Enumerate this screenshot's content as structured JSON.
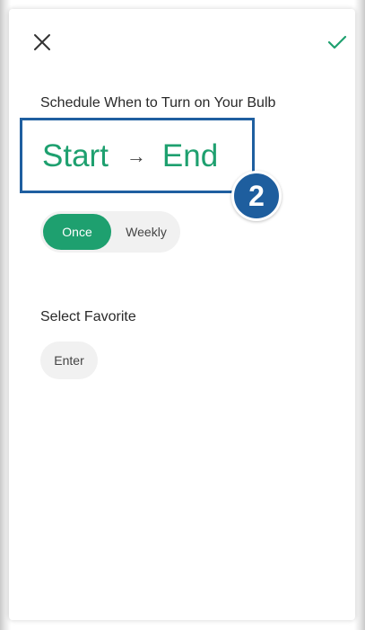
{
  "header": {
    "close_icon": "close-icon",
    "confirm_icon": "checkmark-icon",
    "accent_color": "#1ea06f"
  },
  "schedule": {
    "title": "Schedule When to Turn on Your Bulb",
    "start_label": "Start",
    "arrow": "→",
    "end_label": "End"
  },
  "annotation": {
    "badge_number": "2",
    "highlight_color": "#1f5fa0"
  },
  "repeat": {
    "options": [
      {
        "label": "Once",
        "selected": true
      },
      {
        "label": "Weekly",
        "selected": false
      }
    ]
  },
  "favorite": {
    "label": "Select Favorite",
    "enter_label": "Enter"
  }
}
